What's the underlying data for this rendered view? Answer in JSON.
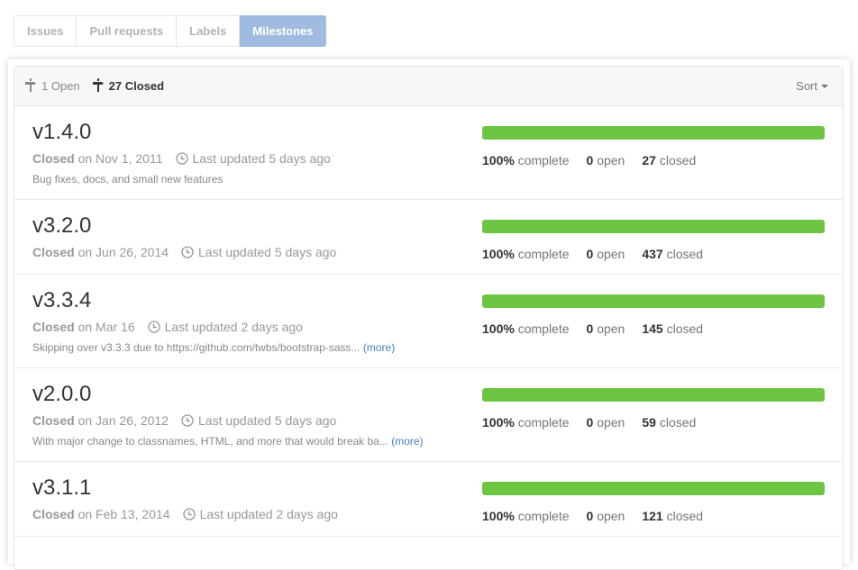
{
  "subnav": {
    "tabs": [
      {
        "label": "Issues",
        "selected": false
      },
      {
        "label": "Pull requests",
        "selected": false
      },
      {
        "label": "Labels",
        "selected": false
      },
      {
        "label": "Milestones",
        "selected": true
      }
    ]
  },
  "header": {
    "open_count": "1",
    "open_label": "Open",
    "closed_count": "27",
    "closed_label": "Closed",
    "sort_label": "Sort",
    "icons": {
      "milestone": "milestone-icon",
      "sort": "caret-down-icon"
    }
  },
  "colors": {
    "progress": "#6cc644",
    "selected_tab": "#9fbbe0",
    "link": "#4183c4"
  },
  "milestones": [
    {
      "title": "v1.4.0",
      "state": "Closed",
      "closed_on": "on Nov 1, 2011",
      "updated": "Last updated 5 days ago",
      "description": "Bug fixes, docs, and small new features",
      "more": "",
      "percent": 100,
      "percent_label": "100%",
      "complete_label": "complete",
      "open": "0",
      "open_label": "open",
      "closed": "27",
      "closed_label": "closed"
    },
    {
      "title": "v3.2.0",
      "state": "Closed",
      "closed_on": "on Jun 26, 2014",
      "updated": "Last updated 5 days ago",
      "description": "",
      "more": "",
      "percent": 100,
      "percent_label": "100%",
      "complete_label": "complete",
      "open": "0",
      "open_label": "open",
      "closed": "437",
      "closed_label": "closed"
    },
    {
      "title": "v3.3.4",
      "state": "Closed",
      "closed_on": "on Mar 16",
      "updated": "Last updated 2 days ago",
      "description": "Skipping over v3.3.3 due to https://github.com/twbs/bootstrap-sass...",
      "more": "(more)",
      "percent": 100,
      "percent_label": "100%",
      "complete_label": "complete",
      "open": "0",
      "open_label": "open",
      "closed": "145",
      "closed_label": "closed"
    },
    {
      "title": "v2.0.0",
      "state": "Closed",
      "closed_on": "on Jan 26, 2012",
      "updated": "Last updated 5 days ago",
      "description": "With major change to classnames, HTML, and more that would break ba...",
      "more": "(more)",
      "percent": 100,
      "percent_label": "100%",
      "complete_label": "complete",
      "open": "0",
      "open_label": "open",
      "closed": "59",
      "closed_label": "closed"
    },
    {
      "title": "v3.1.1",
      "state": "Closed",
      "closed_on": "on Feb 13, 2014",
      "updated": "Last updated 2 days ago",
      "description": "",
      "more": "",
      "percent": 100,
      "percent_label": "100%",
      "complete_label": "complete",
      "open": "0",
      "open_label": "open",
      "closed": "121",
      "closed_label": "closed"
    }
  ]
}
